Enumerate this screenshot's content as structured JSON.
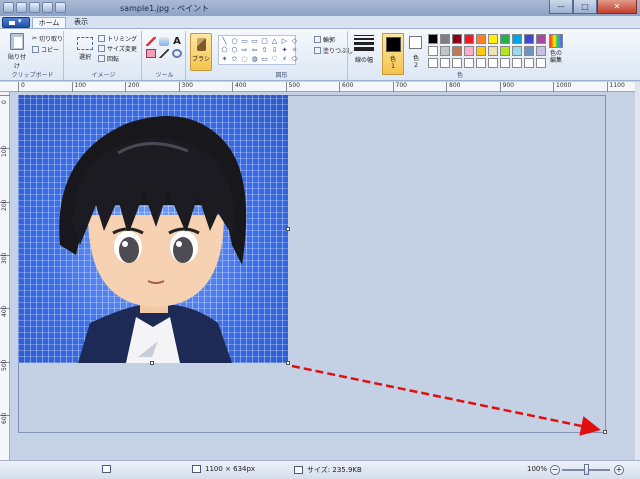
{
  "window": {
    "title": "sample1.jpg - ペイント",
    "minimize": "—",
    "maximize": "□",
    "close": "✕"
  },
  "tabs": {
    "home": "ホーム",
    "view": "表示"
  },
  "ribbon": {
    "clipboard": {
      "paste": "貼り付け",
      "cut": "切り取り",
      "copy": "コピー",
      "label": "クリップボード"
    },
    "image": {
      "select": "選択",
      "crop": "トリミング",
      "resize": "サイズ変更",
      "rotate": "回転",
      "label": "イメージ"
    },
    "tools": {
      "label": "ツール",
      "text_tool": "A"
    },
    "brush": {
      "label": "ブラシ"
    },
    "shapes": {
      "glyphs": [
        "╲",
        "○",
        "▭",
        "▭",
        "▢",
        "△",
        "▷",
        "◇",
        "⬠",
        "⬡",
        "⇨",
        "⇦",
        "⇧",
        "⇩",
        "✦",
        "✧",
        "✶",
        "✩",
        "◌",
        "◍",
        "▭",
        "♡",
        "⚡",
        "⬭"
      ],
      "outline": "輪郭",
      "fill": "塗りつぶし",
      "label": "図形"
    },
    "line_width": {
      "label": "線の幅"
    },
    "colors": {
      "color1": "色\n1",
      "color2": "色\n2",
      "edit": "色の\n編集",
      "label": "色",
      "palette": [
        "#000000",
        "#7f7f7f",
        "#880015",
        "#ed1c24",
        "#ff7f27",
        "#fff200",
        "#22b14c",
        "#00a2e8",
        "#3f48cc",
        "#a349a4",
        "#ffffff",
        "#c3c3c3",
        "#b97a57",
        "#ffaec9",
        "#ffc90e",
        "#efe4b0",
        "#b5e61d",
        "#99d9ea",
        "#7092be",
        "#c8bfe7",
        "#ffffff",
        "#ffffff",
        "#ffffff",
        "#ffffff",
        "#ffffff",
        "#ffffff",
        "#ffffff",
        "#ffffff",
        "#ffffff",
        "#ffffff"
      ]
    }
  },
  "ruler": {
    "top": [
      "0",
      "100",
      "200",
      "300",
      "400",
      "500",
      "600",
      "700",
      "800",
      "900",
      "1000",
      "1100"
    ],
    "left": [
      "0",
      "100",
      "200",
      "300",
      "400",
      "500",
      "600"
    ]
  },
  "status": {
    "dimensions": "1100 × 634px",
    "size": "サイズ: 235.9KB",
    "zoom": "100%"
  }
}
